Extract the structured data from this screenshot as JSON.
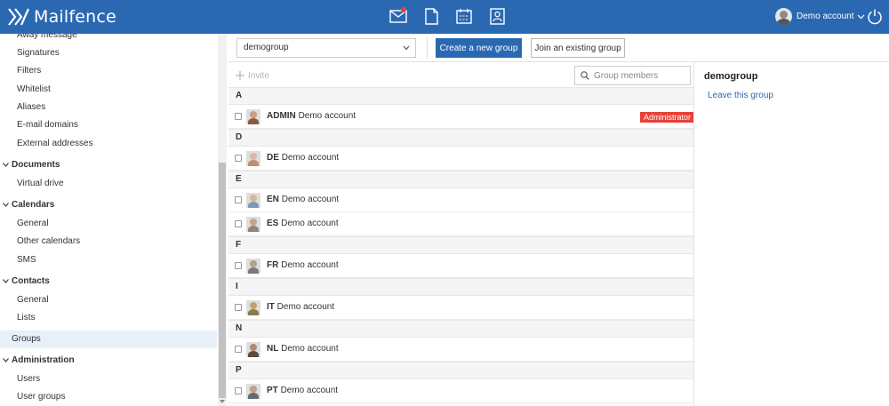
{
  "header": {
    "brand": "Mailfence",
    "account_name": "Demo account",
    "nav": [
      {
        "icon": "mail-icon",
        "has_badge": true
      },
      {
        "icon": "document-icon",
        "has_badge": false
      },
      {
        "icon": "calendar-icon",
        "has_badge": false
      },
      {
        "icon": "contacts-icon",
        "has_badge": false
      }
    ],
    "colors": {
      "bar": "#2a69b2",
      "badge": "#e8413b"
    }
  },
  "sidebar": {
    "items": [
      {
        "label": "Away message",
        "kind": "sub"
      },
      {
        "label": "Signatures",
        "kind": "sub"
      },
      {
        "label": "Filters",
        "kind": "sub"
      },
      {
        "label": "Whitelist",
        "kind": "sub"
      },
      {
        "label": "Aliases",
        "kind": "sub"
      },
      {
        "label": "E-mail domains",
        "kind": "sub"
      },
      {
        "label": "External addresses",
        "kind": "sub"
      },
      {
        "label": "Documents",
        "kind": "head"
      },
      {
        "label": "Virtual drive",
        "kind": "sub"
      },
      {
        "label": "Calendars",
        "kind": "head"
      },
      {
        "label": "General",
        "kind": "sub"
      },
      {
        "label": "Other calendars",
        "kind": "sub"
      },
      {
        "label": "SMS",
        "kind": "sub"
      },
      {
        "label": "Contacts",
        "kind": "head"
      },
      {
        "label": "General",
        "kind": "sub"
      },
      {
        "label": "Lists",
        "kind": "sub"
      },
      {
        "label": "Groups",
        "kind": "active"
      },
      {
        "label": "Administration",
        "kind": "head"
      },
      {
        "label": "Users",
        "kind": "sub"
      },
      {
        "label": "User groups",
        "kind": "sub"
      }
    ]
  },
  "toolbar": {
    "selected_group": "demogroup",
    "create_label": "Create a new group",
    "join_label": "Join an existing group"
  },
  "members": {
    "invite_label": "Invite",
    "search_placeholder": "Group members",
    "admin_badge": "Administrator",
    "sections": [
      {
        "letter": "A",
        "rows": [
          {
            "code": "ADMIN",
            "name": "Demo account",
            "admin": true,
            "avatar": "#8a5a3c"
          }
        ]
      },
      {
        "letter": "D",
        "rows": [
          {
            "code": "DE",
            "name": "Demo account",
            "admin": false,
            "avatar": "#c48c72"
          }
        ]
      },
      {
        "letter": "E",
        "rows": [
          {
            "code": "EN",
            "name": "Demo account",
            "admin": false,
            "avatar": "#7f98b8"
          },
          {
            "code": "ES",
            "name": "Demo account",
            "admin": false,
            "avatar": "#9a8270"
          }
        ]
      },
      {
        "letter": "F",
        "rows": [
          {
            "code": "FR",
            "name": "Demo account",
            "admin": false,
            "avatar": "#7a7a7a"
          }
        ]
      },
      {
        "letter": "I",
        "rows": [
          {
            "code": "IT",
            "name": "Demo account",
            "admin": false,
            "avatar": "#8a7a50"
          }
        ]
      },
      {
        "letter": "N",
        "rows": [
          {
            "code": "NL",
            "name": "Demo account",
            "admin": false,
            "avatar": "#5a4a3c"
          }
        ]
      },
      {
        "letter": "P",
        "rows": [
          {
            "code": "PT",
            "name": "Demo account",
            "admin": false,
            "avatar": "#6a6a6a"
          }
        ]
      }
    ]
  },
  "details": {
    "title": "demogroup",
    "leave_label": "Leave this group"
  }
}
